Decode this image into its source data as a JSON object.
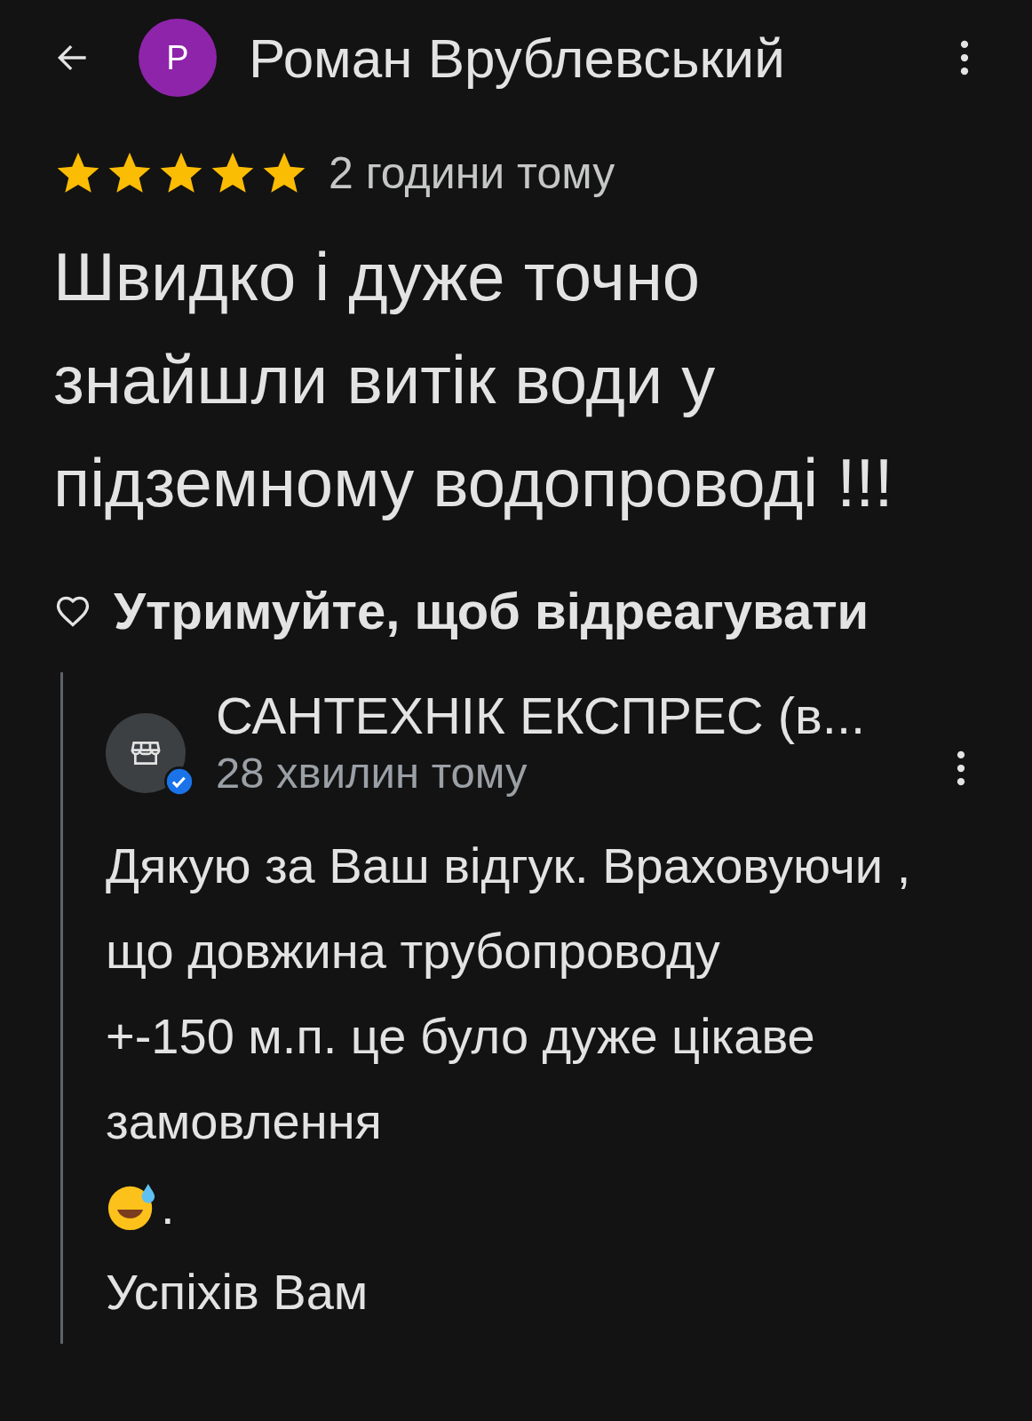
{
  "header": {
    "avatar_letter": "Р",
    "name": "Роман Врублевський"
  },
  "review": {
    "stars": 5,
    "time": "2 години тому",
    "text": "Швидко і дуже точно\nзнайшли витік води у\nпідземному водопроводі !!!",
    "react_label": "Утримуйте, щоб відреагувати"
  },
  "reply": {
    "name": "САНТЕХНІК ЕКСПРЕС (в...",
    "verified": true,
    "time": "28 хвилин тому",
    "paragraphs": [
      {
        "kind": "text",
        "text": "Дякую за Ваш відгук. Враховуючи ,\nщо довжина трубопроводу\n+-150 м.п. це було дуже цікаве\nзамовлення"
      },
      {
        "kind": "emoji",
        "text": "."
      },
      {
        "kind": "text",
        "text": "Успіхів Вам"
      }
    ]
  }
}
